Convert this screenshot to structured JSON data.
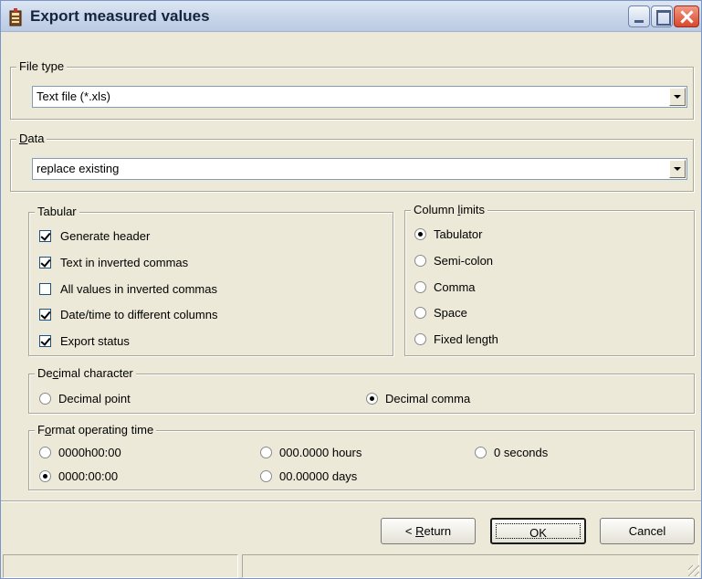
{
  "window": {
    "title": "Export measured values"
  },
  "file_type": {
    "label": "File type",
    "value": "Text file (*.xls)"
  },
  "data_group": {
    "label_underlined": "D",
    "label_rest": "ata",
    "value": "replace existing"
  },
  "tabular": {
    "label": "Tabular",
    "options": [
      {
        "label": "Generate header",
        "checked": true
      },
      {
        "label": "Text in inverted commas",
        "checked": true
      },
      {
        "label": "All values in inverted commas",
        "checked": false
      },
      {
        "label": "Date/time to different columns",
        "checked": true
      },
      {
        "label": "Export status",
        "checked": true
      }
    ]
  },
  "column_limits": {
    "label_pre": "Column ",
    "label_underlined": "l",
    "label_post": "imits",
    "options": [
      {
        "label": "Tabulator",
        "selected": true
      },
      {
        "label": "Semi-colon",
        "selected": false
      },
      {
        "label": "Comma",
        "selected": false
      },
      {
        "label": "Space",
        "selected": false
      },
      {
        "label": "Fixed length",
        "selected": false
      }
    ]
  },
  "decimal_character": {
    "label_pre": "De",
    "label_underlined": "c",
    "label_post": "imal character",
    "options": [
      {
        "label": "Decimal point",
        "selected": false
      },
      {
        "label": "Decimal comma",
        "selected": true
      }
    ]
  },
  "format_operating_time": {
    "label_pre": "F",
    "label_underlined": "o",
    "label_post": "rmat operating time",
    "options": [
      {
        "label": "0000h00:00",
        "selected": false
      },
      {
        "label": "000.0000 hours",
        "selected": false
      },
      {
        "label": "0 seconds",
        "selected": false
      },
      {
        "label": "0000:00:00",
        "selected": true
      },
      {
        "label": "00.00000 days",
        "selected": false
      }
    ]
  },
  "buttons": {
    "return_pre": "< ",
    "return_underlined": "R",
    "return_post": "eturn",
    "ok": "OK",
    "cancel": "Cancel"
  },
  "icons": {
    "app": "export-app-icon",
    "minimize": "minimize-icon",
    "maximize": "maximize-icon",
    "close": "close-icon",
    "dropdown": "chevron-down-icon",
    "grip": "resize-grip-icon"
  },
  "colors": {
    "face": "#ece9d8",
    "close_button": "#d8482c",
    "titlebar": "#c9d6ea"
  }
}
